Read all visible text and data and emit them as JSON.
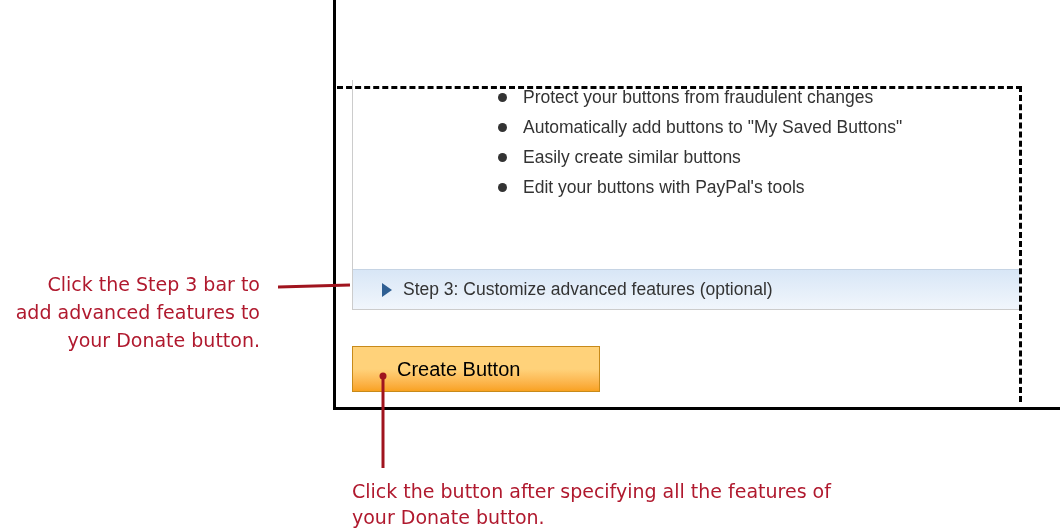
{
  "panel": {
    "features": [
      "Protect your buttons from fraudulent changes",
      "Automatically add buttons to \"My Saved Buttons\"",
      "Easily create similar buttons",
      "Edit your buttons with PayPal's tools"
    ],
    "step_bar": {
      "label": "Step 3: Customize advanced features (optional)",
      "expanded": false
    }
  },
  "create_button": {
    "label": "Create Button"
  },
  "callouts": [
    {
      "text": "Click the Step 3 bar to add advanced features to your Donate button."
    },
    {
      "text": "Click the button after specifying all the features of your Donate button."
    }
  ]
}
